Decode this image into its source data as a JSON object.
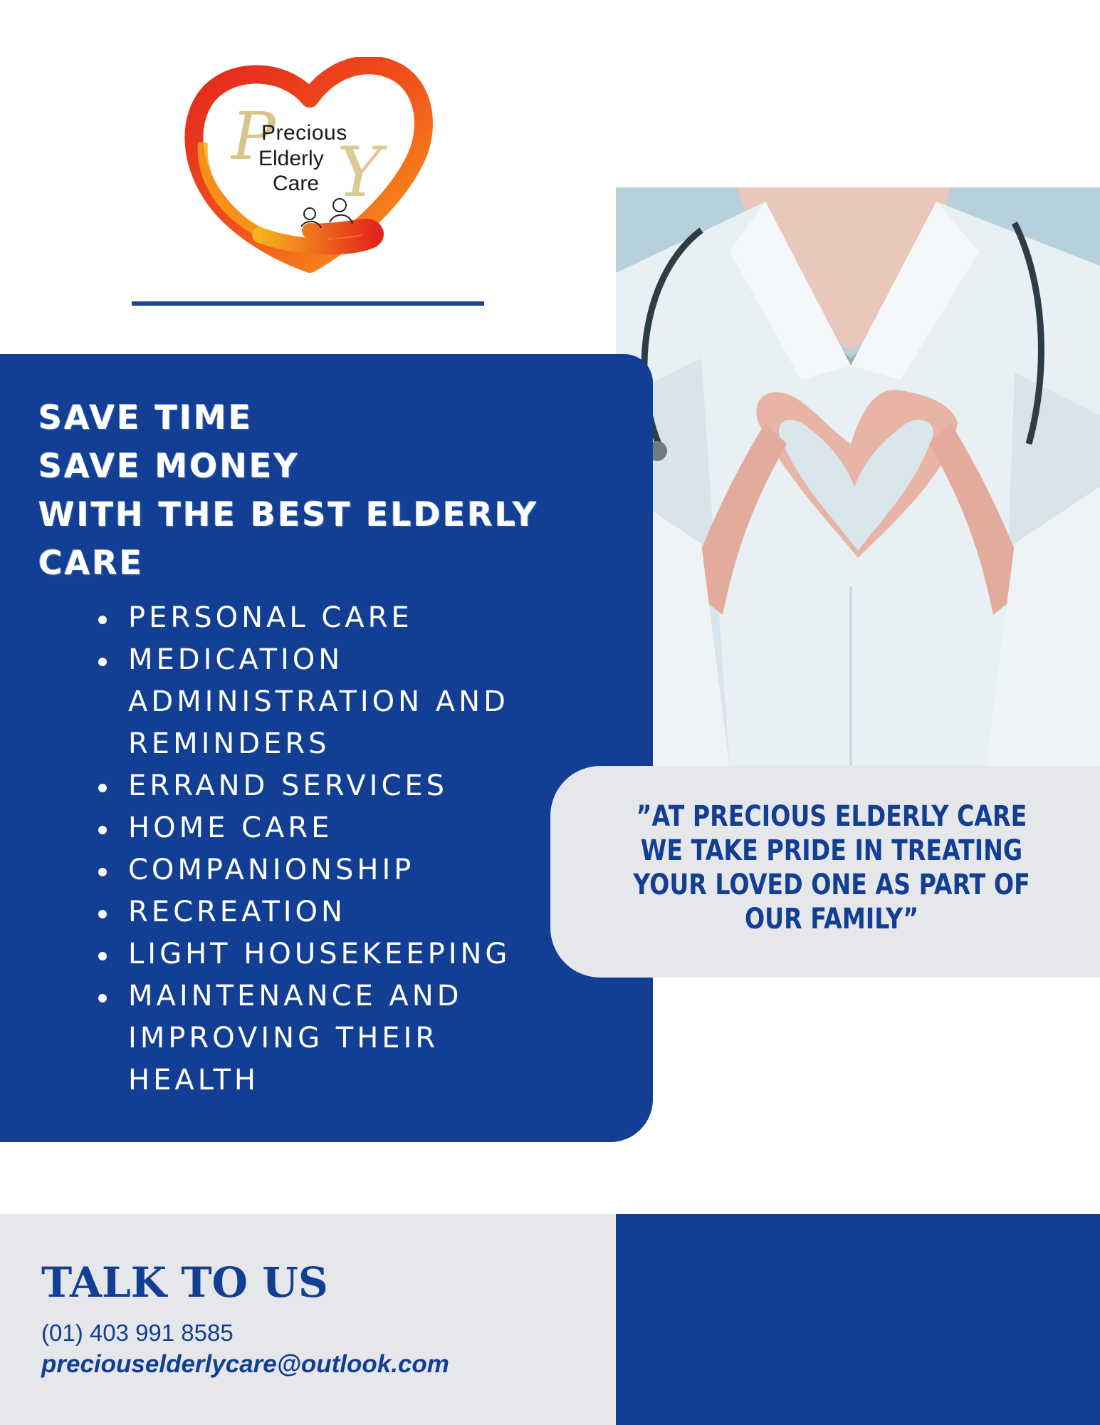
{
  "logo": {
    "line1": "Precious",
    "line2": "Elderly",
    "line3": "Care"
  },
  "headline": {
    "line1": "SAVE TIME",
    "line2": "SAVE MONEY",
    "line3": "WITH THE BEST ELDERLY",
    "line4": "CARE"
  },
  "services": [
    "PERSONAL CARE",
    "MEDICATION ADMINISTRATION AND REMINDERS",
    "ERRAND SERVICES",
    "HOME CARE",
    "COMPANIONSHIP",
    "RECREATION",
    "LIGHT HOUSEKEEPING",
    "MAINTENANCE AND IMPROVING  THEIR HEALTH"
  ],
  "quote": "”AT PRECIOUS ELDERLY CARE WE TAKE PRIDE IN TREATING YOUR LOVED ONE AS PART OF OUR FAMILY”",
  "contact": {
    "heading": "TALK TO US",
    "phone": "(01) 403 991 8585",
    "email": "preciouselderlycare@outlook.com"
  },
  "colors": {
    "brand_blue": "#123f94",
    "light_gray": "#e6e7ea",
    "logo_red": "#e4261c",
    "logo_orange": "#f28c1a"
  },
  "icons": {
    "logo": "heart-hand-logo-icon",
    "photo": "doctor-heart-hands-photo"
  }
}
